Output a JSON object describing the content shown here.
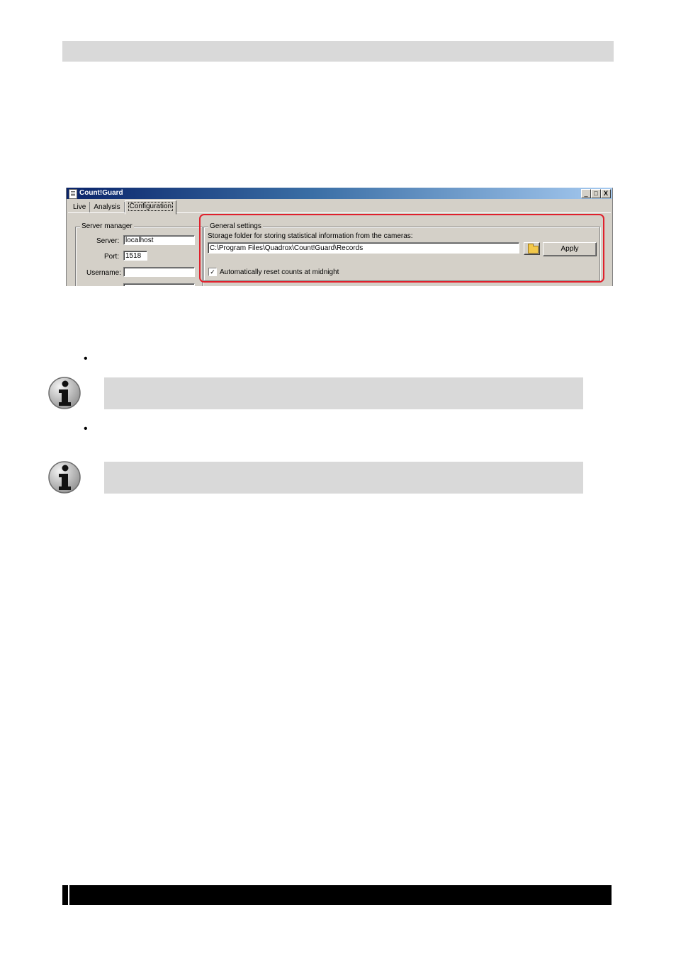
{
  "window": {
    "title": "Count!Guard",
    "controls": {
      "minimize": "_",
      "maximize": "□",
      "close": "X"
    },
    "tabs": [
      {
        "label": "Live",
        "active": false
      },
      {
        "label": "Analysis",
        "active": false
      },
      {
        "label": "Configuration",
        "active": true
      }
    ],
    "server_manager": {
      "legend": "Server manager",
      "server_label": "Server:",
      "server_value": "localhost",
      "port_label": "Port:",
      "port_value": "1518",
      "username_label": "Username:",
      "username_value": ""
    },
    "general_settings": {
      "legend": "General settings",
      "storage_label": "Storage folder for storing statistical information from the cameras:",
      "storage_path": "C:\\Program Files\\Quadrox\\Count!Guard\\Records",
      "apply_label": "Apply",
      "reset_checkbox_checked": true,
      "reset_label": "Automatically reset counts at midnight"
    },
    "highlight_color": "#e0202c"
  },
  "bullets": [
    "•",
    "•"
  ],
  "icons": [
    "info-icon",
    "info-icon",
    "folder-open-icon",
    "app-icon"
  ]
}
